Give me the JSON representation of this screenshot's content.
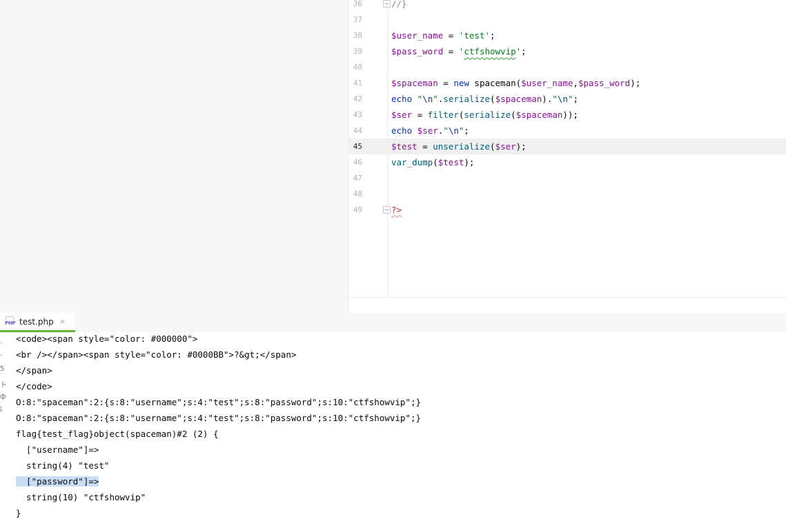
{
  "editor": {
    "lines": [
      {
        "num": "36",
        "parts": [
          {
            "t": "//}",
            "c": "cmt"
          }
        ]
      },
      {
        "num": "37",
        "parts": []
      },
      {
        "num": "38",
        "parts": [
          {
            "t": "$user_name",
            "c": "v"
          },
          {
            "t": " = ",
            "c": "op"
          },
          {
            "t": "'test'",
            "c": "s"
          },
          {
            "t": ";",
            "c": "op"
          }
        ]
      },
      {
        "num": "39",
        "parts": [
          {
            "t": "$pass_word",
            "c": "v"
          },
          {
            "t": " = ",
            "c": "op"
          },
          {
            "t": "'",
            "c": "s"
          },
          {
            "t": "ctfshowvip",
            "c": "s typo"
          },
          {
            "t": "'",
            "c": "s"
          },
          {
            "t": ";",
            "c": "op"
          }
        ]
      },
      {
        "num": "40",
        "parts": []
      },
      {
        "num": "41",
        "parts": [
          {
            "t": "$spaceman",
            "c": "v"
          },
          {
            "t": " = ",
            "c": "op"
          },
          {
            "t": "new",
            "c": "kw-new"
          },
          {
            "t": " spaceman(",
            "c": "op"
          },
          {
            "t": "$user_name",
            "c": "v"
          },
          {
            "t": ",",
            "c": "op"
          },
          {
            "t": "$pass_word",
            "c": "v"
          },
          {
            "t": ");",
            "c": "op"
          }
        ]
      },
      {
        "num": "42",
        "parts": [
          {
            "t": "echo",
            "c": "k"
          },
          {
            "t": " ",
            "c": "op"
          },
          {
            "t": "\"",
            "c": "s"
          },
          {
            "t": "\\n",
            "c": "esc"
          },
          {
            "t": "\"",
            "c": "s"
          },
          {
            "t": ".",
            "c": "op"
          },
          {
            "t": "serialize",
            "c": "f"
          },
          {
            "t": "(",
            "c": "op"
          },
          {
            "t": "$spaceman",
            "c": "v"
          },
          {
            "t": ").",
            "c": "op"
          },
          {
            "t": "\"",
            "c": "s"
          },
          {
            "t": "\\n",
            "c": "esc"
          },
          {
            "t": "\"",
            "c": "s"
          },
          {
            "t": ";",
            "c": "op"
          }
        ]
      },
      {
        "num": "43",
        "parts": [
          {
            "t": "$ser",
            "c": "v"
          },
          {
            "t": " = ",
            "c": "op"
          },
          {
            "t": "filter",
            "c": "f"
          },
          {
            "t": "(",
            "c": "op"
          },
          {
            "t": "serialize",
            "c": "f"
          },
          {
            "t": "(",
            "c": "op"
          },
          {
            "t": "$spaceman",
            "c": "v"
          },
          {
            "t": "));",
            "c": "op"
          }
        ]
      },
      {
        "num": "44",
        "parts": [
          {
            "t": "echo",
            "c": "k"
          },
          {
            "t": " ",
            "c": "op"
          },
          {
            "t": "$ser",
            "c": "v"
          },
          {
            "t": ".",
            "c": "op"
          },
          {
            "t": "\"",
            "c": "s"
          },
          {
            "t": "\\n",
            "c": "esc"
          },
          {
            "t": "\"",
            "c": "s"
          },
          {
            "t": ";",
            "c": "op"
          }
        ]
      },
      {
        "num": "45",
        "current": true,
        "parts": [
          {
            "t": "$test",
            "c": "v"
          },
          {
            "t": " = ",
            "c": "op"
          },
          {
            "t": "unserialize",
            "c": "f"
          },
          {
            "t": "(",
            "c": "op"
          },
          {
            "t": "$ser",
            "c": "v"
          },
          {
            "t": ");",
            "c": "op"
          }
        ]
      },
      {
        "num": "46",
        "parts": [
          {
            "t": "var_dump",
            "c": "f"
          },
          {
            "t": "(",
            "c": "op"
          },
          {
            "t": "$test",
            "c": "v"
          },
          {
            "t": ");",
            "c": "op"
          }
        ]
      },
      {
        "num": "47",
        "parts": []
      },
      {
        "num": "48",
        "parts": []
      },
      {
        "num": "49",
        "parts": [
          {
            "t": "?>",
            "c": "php-tag"
          }
        ]
      }
    ]
  },
  "run_tab": {
    "icon": "php-file-icon",
    "icon_label": "PHP",
    "title": "test.php",
    "close": "×"
  },
  "output": {
    "gutter_glyphs": [
      ".",
      "-",
      "5",
      "ト",
      "ф",
      "ī"
    ],
    "lines": [
      "<code><span style=\"color: #000000\">",
      "<br /></span><span style=\"color: #0000BB\">?&gt;</span>",
      "</span>",
      "</code>",
      "O:8:\"spaceman\":2:{s:8:\"username\";s:4:\"test\";s:8:\"password\";s:10:\"ctfshowvip\";}",
      "O:8:\"spaceman\":2:{s:8:\"username\";s:4:\"test\";s:8:\"password\";s:10:\"ctfshowvip\";}",
      "flag{test_flag}object(spaceman)#2 (2) {",
      "  [\"username\"]=>",
      "  string(4) \"test\"",
      "  [\"password\"]=>",
      "  string(10) \"ctfshowvip\"",
      "}"
    ],
    "selected_line_index": 9
  }
}
